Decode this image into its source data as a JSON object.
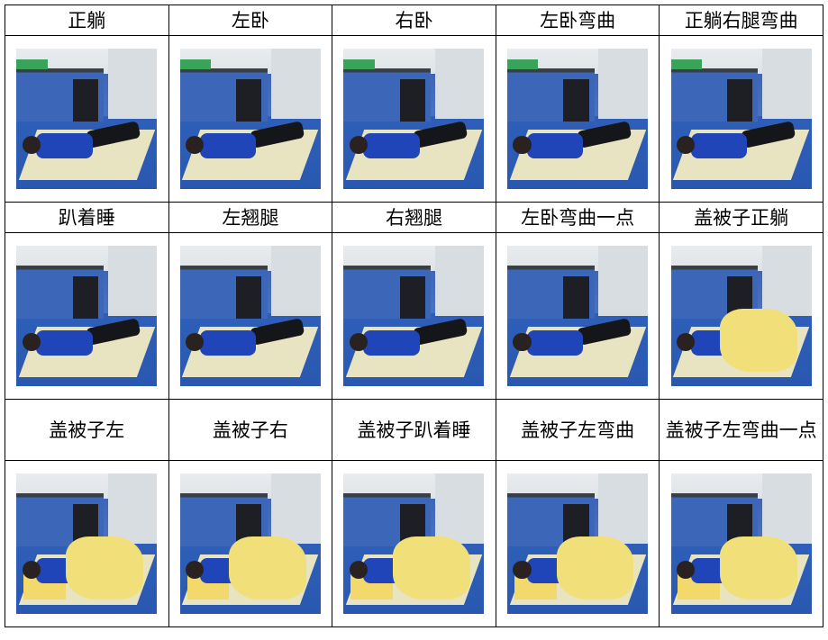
{
  "rows": [
    [
      "正躺",
      "左卧",
      "右卧",
      "左卧弯曲",
      "正躺右腿弯曲"
    ],
    [
      "趴着睡",
      "左翘腿",
      "右翘腿",
      "左卧弯曲一点",
      "盖被子正躺"
    ],
    [
      "盖被子左",
      "盖被子右",
      "盖被子趴着睡",
      "盖被子左弯曲",
      "盖被子左弯曲一点"
    ]
  ]
}
